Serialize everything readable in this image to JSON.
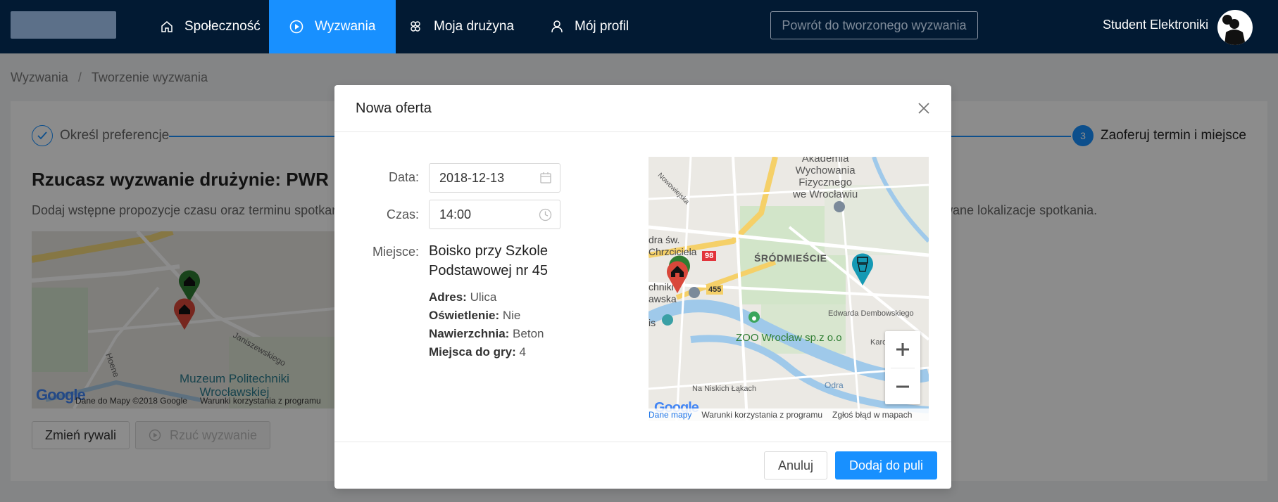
{
  "nav": {
    "items": [
      {
        "label": "Społeczność",
        "icon": "home-icon"
      },
      {
        "label": "Wyzwania",
        "icon": "play-circle-icon"
      },
      {
        "label": "Moja drużyna",
        "icon": "team-icon"
      },
      {
        "label": "Mój profil",
        "icon": "user-icon"
      }
    ],
    "back_button": "Powrót do tworzonego wyzwania",
    "user_name": "Student Elektroniki"
  },
  "breadcrumb": [
    "Wyzwania",
    "/",
    "Tworzenie wyzwania"
  ],
  "steps": {
    "first": {
      "label": "Określ preferencje",
      "icon": "check-icon"
    },
    "last": {
      "number": "3",
      "label": "Zaoferuj termin i miejsce"
    }
  },
  "page": {
    "heading": "Rzucasz wyzwanie drużynie: PWR Ele",
    "description": "Dodaj wstępne propozycje czasu oraz terminu spotkania",
    "description_right": "wane lokalizacje spotkania.",
    "bg_map": {
      "footer_data": "Dane do Mapy ©2018 Google",
      "footer_terms": "Warunki korzystania z programu",
      "museum_label": "Muzeum Politechniki\nWrocławskiej",
      "street": "Janiszewskiego",
      "street2": "Hoene"
    },
    "change_rivals": "Zmień rywali",
    "throw_challenge": "Rzuć wyzwanie"
  },
  "modal": {
    "title": "Nowa oferta",
    "date_label": "Data:",
    "date_value": "2018-12-13",
    "time_label": "Czas:",
    "time_value": "14:00",
    "place_label": "Miejsce:",
    "place_name": "Boisko przy Szkole Podstawowej nr 45",
    "details": [
      {
        "label": "Adres:",
        "value": "Ulica"
      },
      {
        "label": "Oświetlenie:",
        "value": "Nie"
      },
      {
        "label": "Nawierzchnia:",
        "value": "Beton"
      },
      {
        "label": "Miejsca do gry:",
        "value": "4"
      }
    ],
    "map": {
      "labels": {
        "akademia": "Akademia\nWychowania\nFizycznego\nwe Wrocławiu",
        "srodmiescie": "ŚRÓDMIEŚCIE",
        "chrzciciela": "dra św.\nChrzciciela",
        "techniki": "chniki\nawska",
        "zoo": "ZOO Wrocław sp.z o.o",
        "dembowskiego": "Edwarda Dembowskiego",
        "odra": "Odra",
        "na_niskich": "Na Niskich Łąkach",
        "nowowiejska": "Nowowiejska",
        "kar": "Karo",
        "route98": "98",
        "route455": "455",
        "is": "is"
      },
      "footer_data": "Dane mapy",
      "footer_terms": "Warunki korzystania z programu",
      "footer_report": "Zgłoś błąd w mapach"
    },
    "cancel": "Anuluj",
    "submit": "Dodaj do puli"
  },
  "colors": {
    "nav_bg": "#021a33",
    "primary": "#1890ff",
    "pin_red": "#d9473a",
    "pin_green": "#2f7d32",
    "pin_teal": "#1599b4"
  }
}
